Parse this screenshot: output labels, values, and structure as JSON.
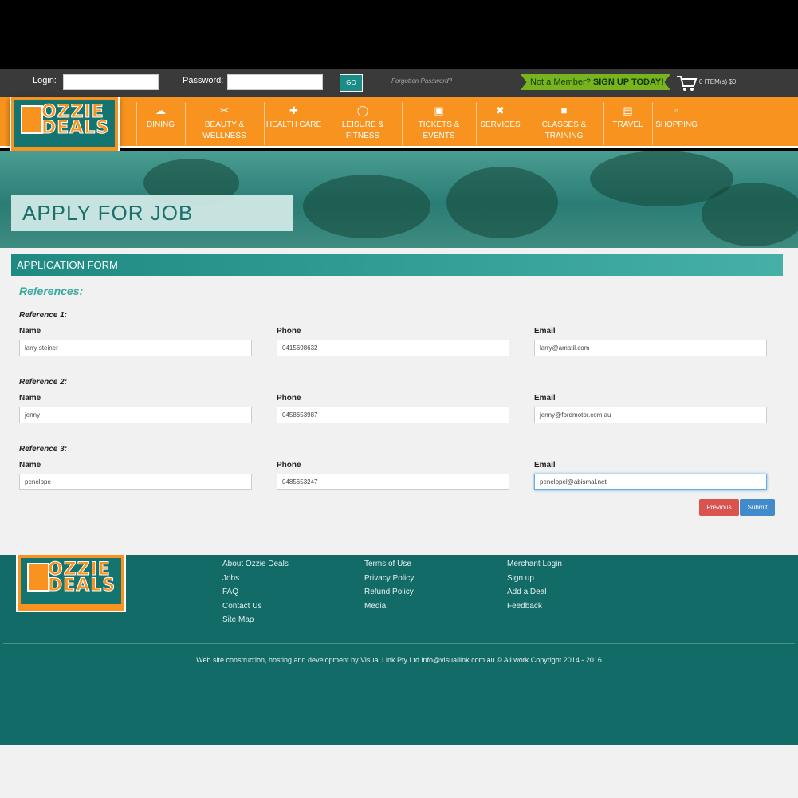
{
  "topbar": {
    "login_label": "Login:",
    "password_label": "Password:",
    "go_label": "GO",
    "forgot_label": "Forgotten Password?",
    "not_member": "Not a Member?",
    "signup_label": "SIGN UP TODAY!",
    "cart_text": "0 ITEM(s) $0"
  },
  "brand": {
    "line1": "OZZIE",
    "line2": "DEALS"
  },
  "nav": {
    "items": [
      {
        "label": "DINING",
        "icon": "dining-icon"
      },
      {
        "label": "BEAUTY & WELLNESS",
        "icon": "scissors-icon"
      },
      {
        "label": "HEALTH CARE",
        "icon": "health-icon"
      },
      {
        "label": "LEISURE & FITNESS",
        "icon": "shoe-icon"
      },
      {
        "label": "TICKETS & EVENTS",
        "icon": "camera-icon"
      },
      {
        "label": "SERVICES",
        "icon": "tools-icon"
      },
      {
        "label": "CLASSES & TRAINING",
        "icon": "truck-icon"
      },
      {
        "label": "TRAVEL",
        "icon": "suitcase-icon"
      },
      {
        "label": "SHOPPING",
        "icon": "basket-icon"
      }
    ]
  },
  "hero": {
    "title": "APPLY FOR JOB"
  },
  "form": {
    "header": "APPLICATION FORM",
    "section_title": "References:",
    "name_label": "Name",
    "phone_label": "Phone",
    "email_label": "Email",
    "references": [
      {
        "label": "Reference 1:",
        "name": "larry steiner",
        "phone": "0415698632",
        "email": "larry@amatil.com"
      },
      {
        "label": "Reference 2:",
        "name": "jenny",
        "phone": "0458653987",
        "email": "jenny@fordmotor.com.au"
      },
      {
        "label": "Reference 3:",
        "name": "penelope",
        "phone": "0485653247",
        "email": "penelopel@abismal.net"
      }
    ],
    "previous_label": "Previous",
    "submit_label": "Submit"
  },
  "footer": {
    "col1": [
      "About Ozzie Deals",
      "Jobs",
      "FAQ",
      "Contact Us",
      "Site Map"
    ],
    "col2": [
      "Terms of Use",
      "Privacy Policy",
      "Refund Policy",
      "Media"
    ],
    "col3": [
      "Merchant Login",
      "Sign up",
      "Add a Deal",
      "Feedback"
    ],
    "copyright": "Web site construction, hosting and development by Visual Link Pty Ltd info@visuallink.com.au © All work Copyright 2014 - 2016"
  },
  "colors": {
    "orange": "#f7931e",
    "teal": "#126b66",
    "green": "#78b41e",
    "danger": "#d9534f",
    "primary": "#428bca"
  }
}
